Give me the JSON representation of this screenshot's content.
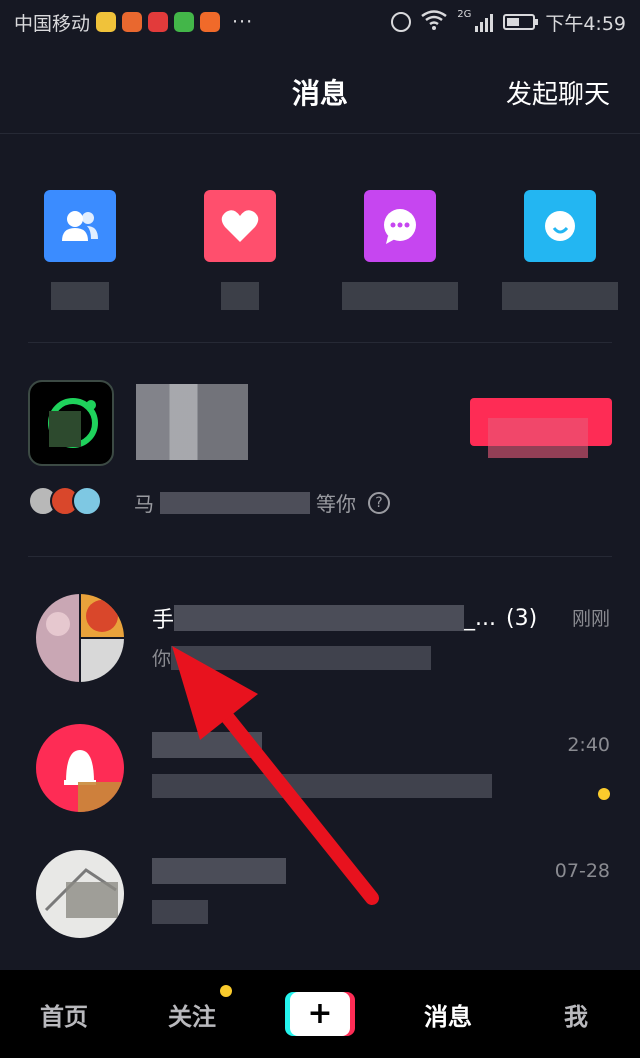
{
  "status_bar": {
    "carrier": "中国移动",
    "more": "···",
    "network": "2G",
    "time": "下午4:59"
  },
  "header": {
    "title": "消息",
    "action": "发起聊天"
  },
  "quick_actions": [
    {
      "icon": "fans-icon",
      "color": "#3b8cff"
    },
    {
      "icon": "heart-icon",
      "color": "#ff4f6d"
    },
    {
      "icon": "mention-icon",
      "color": "#c646f0"
    },
    {
      "icon": "comment-icon",
      "color": "#23b6f2"
    }
  ],
  "promo": {
    "text_prefix": "马",
    "text_suffix": "等你"
  },
  "chats": [
    {
      "title_prefix": "手",
      "title_suffix": "_...",
      "count": "(3)",
      "time": "刚刚",
      "subtitle_prefix": "你"
    },
    {
      "time": "2:40",
      "unread": true
    },
    {
      "time": "07-28"
    }
  ],
  "bottom_nav": {
    "home": "首页",
    "follow": "关注",
    "add": "+",
    "messages": "消息",
    "me": "我"
  },
  "colors": {
    "background": "#161823",
    "accent": "#fe2c55",
    "badge": "#facb2c",
    "annotation": "#e8121e"
  }
}
